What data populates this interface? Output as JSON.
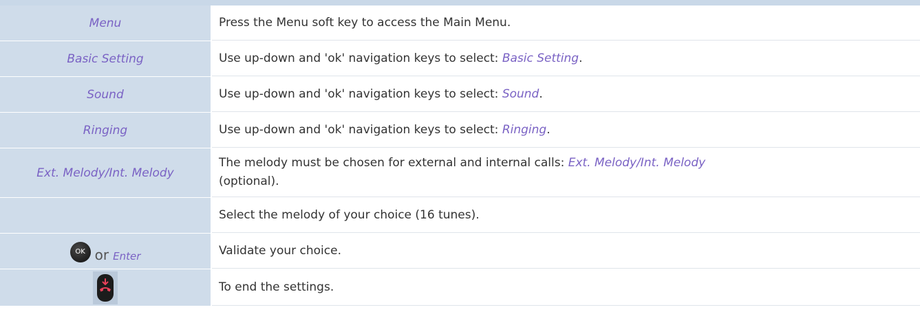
{
  "rows": [
    {
      "left": "Menu",
      "right_text": "Press the Menu soft key to access the Main Menu."
    },
    {
      "left": "Basic Setting",
      "right_prefix": "Use up-down and 'ok' navigation keys to select: ",
      "right_ref": "Basic Setting",
      "right_suffix": "."
    },
    {
      "left": "Sound",
      "right_prefix": "Use up-down and 'ok' navigation keys to select: ",
      "right_ref": "Sound",
      "right_suffix": "."
    },
    {
      "left": "Ringing",
      "right_prefix": "Use up-down and 'ok' navigation keys to select: ",
      "right_ref": "Ringing",
      "right_suffix": "."
    },
    {
      "left": "Ext. Melody/Int. Melody",
      "right_prefix": "The melody must be chosen for external and internal calls: ",
      "right_ref": "Ext. Melody/Int. Melody",
      "right_suffix": "(optional)."
    },
    {
      "left": "",
      "right_text": "Select the melody of your choice (16 tunes)."
    },
    {
      "left_ok_label": "OK",
      "left_or": "or",
      "left_ref": "Enter",
      "left_icon": "ok-key-icon",
      "right_text": "Validate your choice."
    },
    {
      "left_icon": "hang-up-key-icon",
      "right_text": "To end the settings."
    }
  ],
  "colors": {
    "header_bar": "#c9d8e8",
    "left_cell_bg": "#cfdcea",
    "menu_reference": "#7a62c4",
    "body_text": "#333333",
    "hangup_red": "#e8405a"
  }
}
